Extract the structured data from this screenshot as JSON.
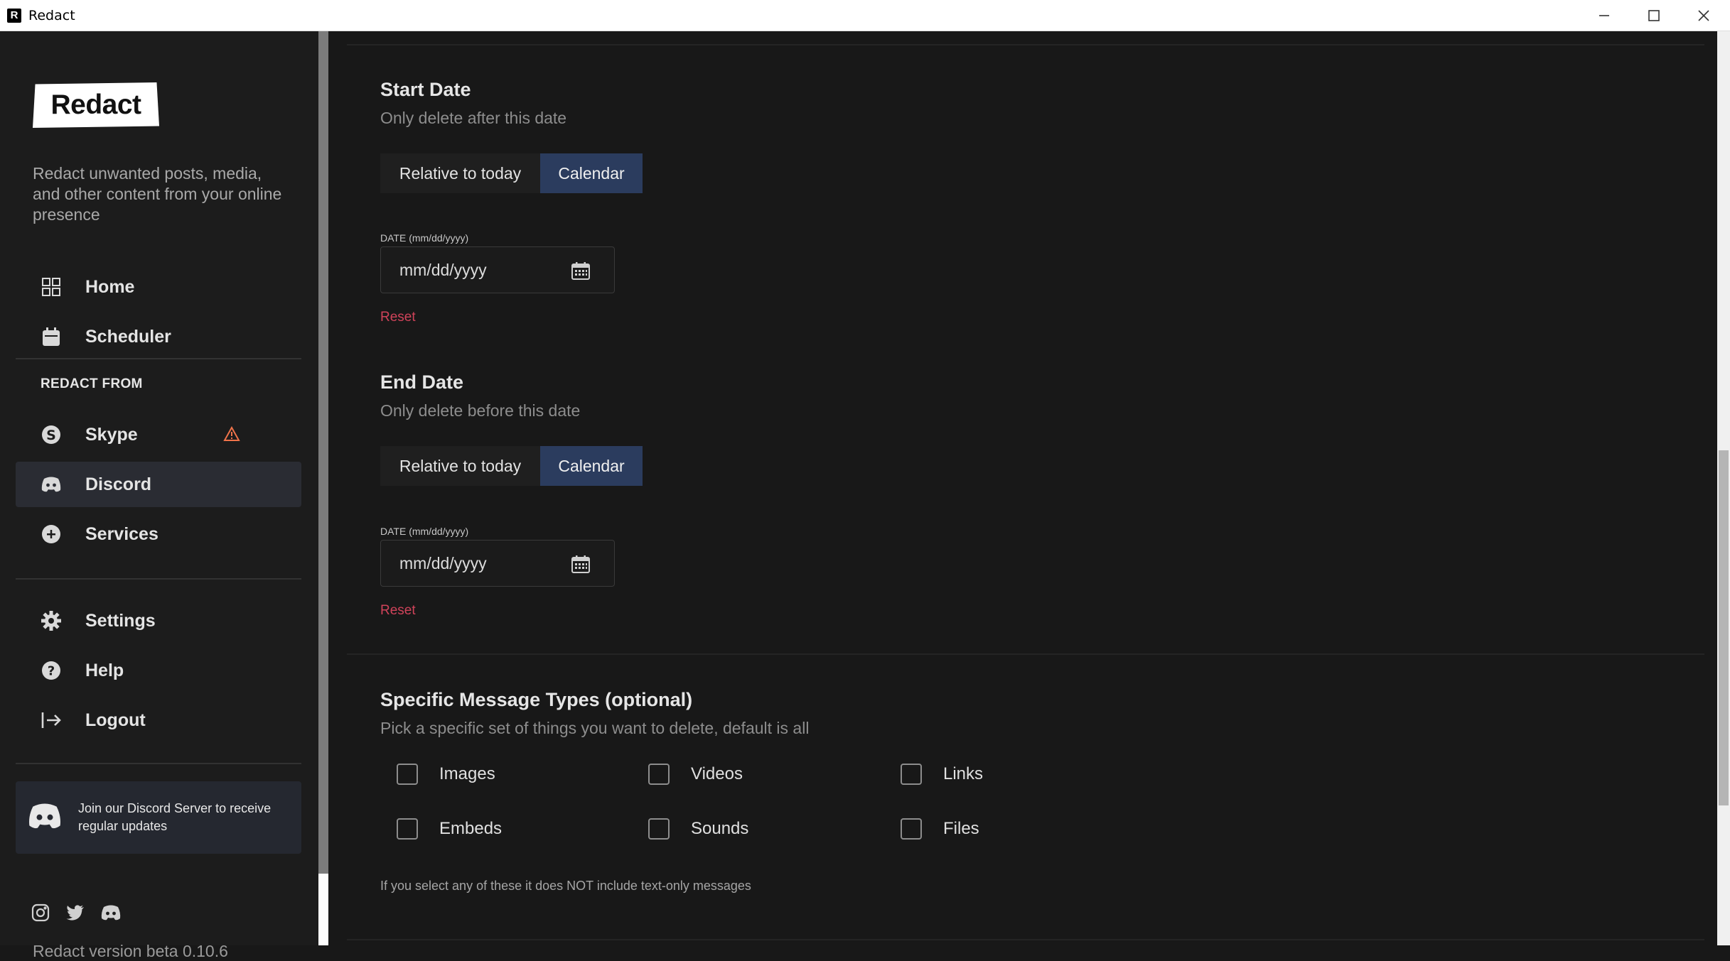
{
  "window": {
    "app_icon_letter": "R",
    "title": "Redact"
  },
  "sidebar": {
    "logo": "Redact",
    "tagline": "Redact unwanted posts, media, and other content from your online presence",
    "nav_top": [
      {
        "label": "Home",
        "icon": "grid-icon"
      },
      {
        "label": "Scheduler",
        "icon": "calendar-icon"
      }
    ],
    "section_label": "REDACT FROM",
    "services": [
      {
        "label": "Skype",
        "icon": "skype-icon",
        "warning": true,
        "active": false
      },
      {
        "label": "Discord",
        "icon": "discord-icon",
        "warning": false,
        "active": true
      },
      {
        "label": "Services",
        "icon": "plus-circle-icon",
        "warning": false,
        "active": false
      }
    ],
    "nav_bottom": [
      {
        "label": "Settings",
        "icon": "gear-icon"
      },
      {
        "label": "Help",
        "icon": "help-icon"
      },
      {
        "label": "Logout",
        "icon": "logout-icon"
      }
    ],
    "discord_card": "Join our Discord Server to receive regular updates",
    "social_icons": [
      "instagram-icon",
      "twitter-icon",
      "discord-icon"
    ],
    "version": "Redact version beta 0.10.6"
  },
  "main": {
    "start_date": {
      "title": "Start Date",
      "subtitle": "Only delete after this date",
      "toggle_relative": "Relative to today",
      "toggle_calendar": "Calendar",
      "selected_toggle": "Calendar",
      "field_label": "DATE (mm/dd/yyyy)",
      "placeholder": "mm/dd/yyyy",
      "reset": "Reset"
    },
    "end_date": {
      "title": "End Date",
      "subtitle": "Only delete before this date",
      "toggle_relative": "Relative to today",
      "toggle_calendar": "Calendar",
      "selected_toggle": "Calendar",
      "field_label": "DATE (mm/dd/yyyy)",
      "placeholder": "mm/dd/yyyy",
      "reset": "Reset"
    },
    "message_types": {
      "title": "Specific Message Types (optional)",
      "subtitle": "Pick a specific set of things you want to delete, default is all",
      "options": [
        {
          "label": "Images",
          "checked": false
        },
        {
          "label": "Videos",
          "checked": false
        },
        {
          "label": "Links",
          "checked": false
        },
        {
          "label": "Embeds",
          "checked": false
        },
        {
          "label": "Sounds",
          "checked": false
        },
        {
          "label": "Files",
          "checked": false
        }
      ],
      "note": "If you select any of these it does NOT include text-only messages"
    }
  },
  "colors": {
    "background": "#181818",
    "sidebar": "#1c1c1c",
    "active_nav": "#2a2c33",
    "toggle_selected": "#2b3c5e",
    "reset": "#d0435a",
    "warning": "#f0734a"
  }
}
